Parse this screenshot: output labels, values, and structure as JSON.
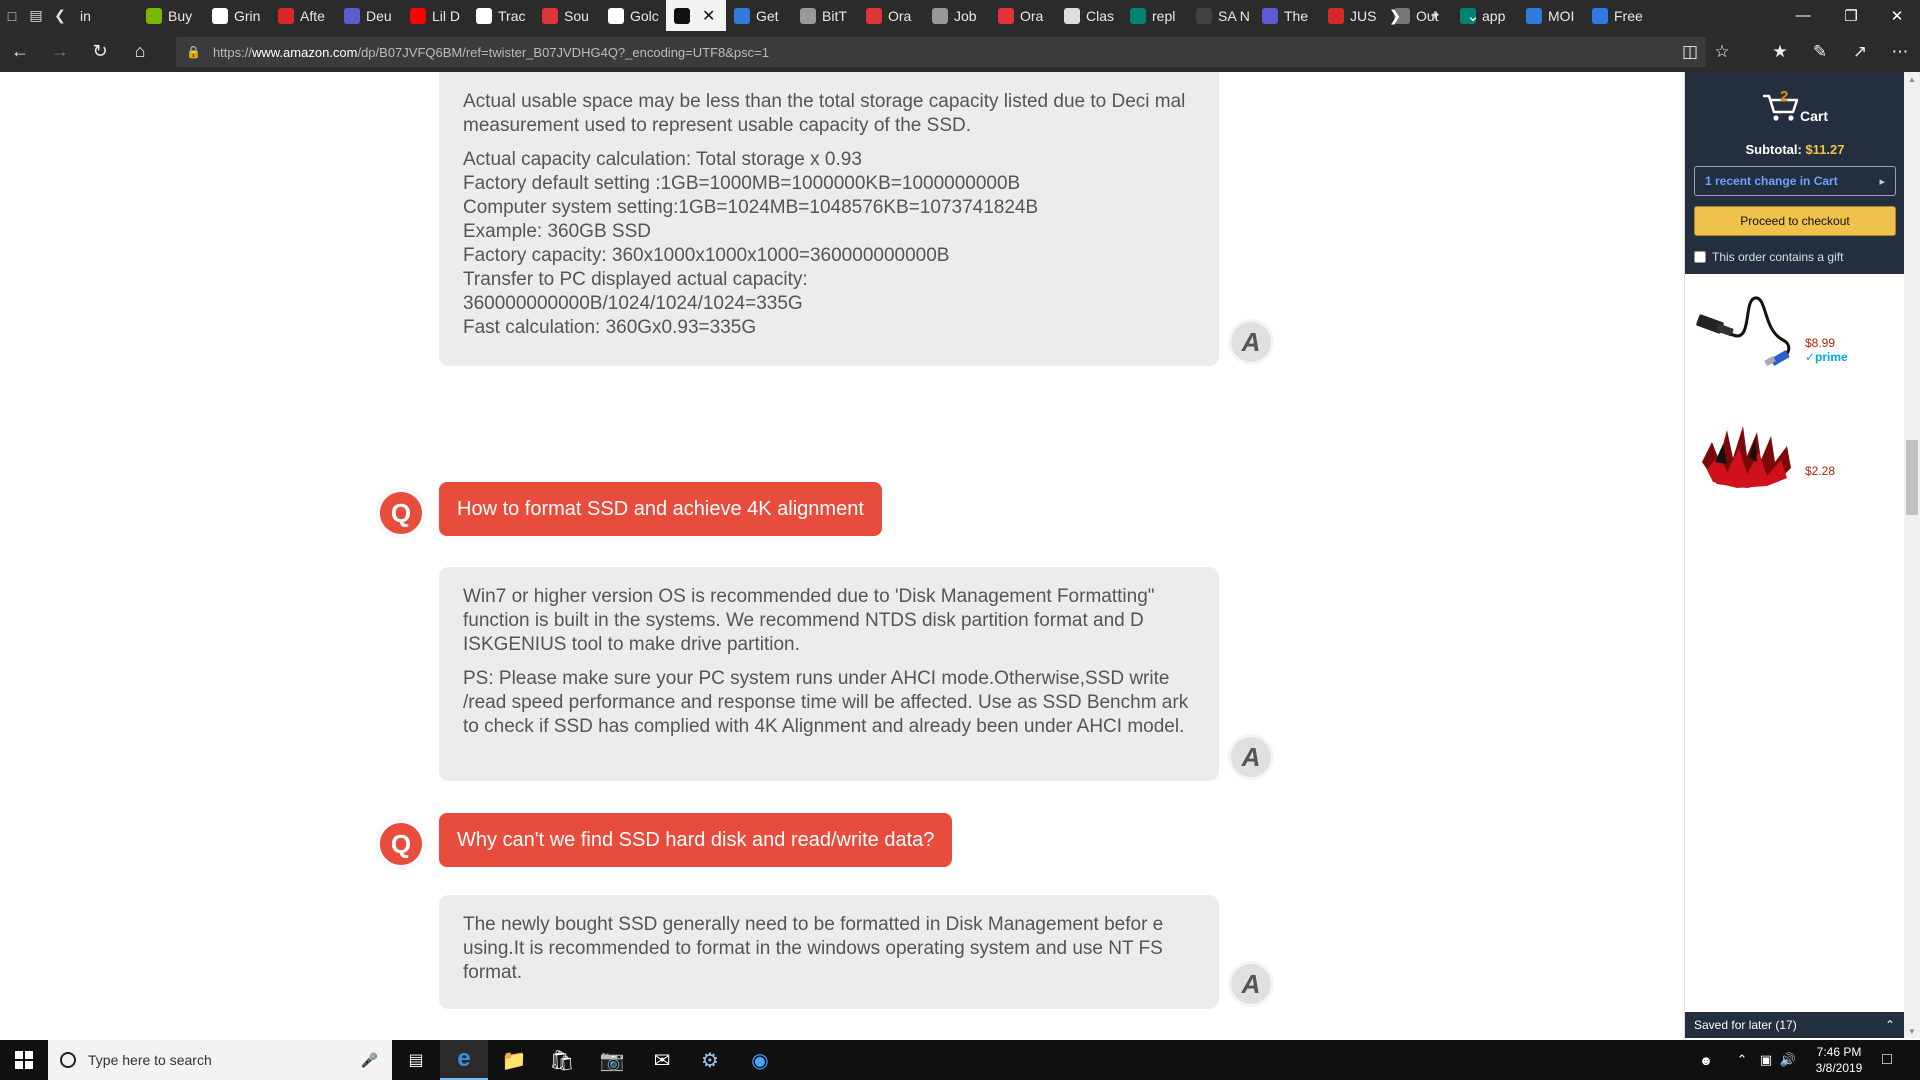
{
  "browser": {
    "tabs": [
      {
        "label": "in",
        "icon": "back-chevron-icon",
        "color": "#2b2b2b"
      },
      {
        "label": "Buy",
        "icon": "nvidia-icon",
        "color": "#76b900"
      },
      {
        "label": "Grin",
        "icon": "grid-icon",
        "color": "#ffffff"
      },
      {
        "label": "Afte",
        "icon": "red-site-icon",
        "color": "#d62828"
      },
      {
        "label": "Deu",
        "icon": "g-icon",
        "color": "#5b5bd6"
      },
      {
        "label": "Lil D",
        "icon": "youtube-icon",
        "color": "#ff0000"
      },
      {
        "label": "Trac",
        "icon": "amazon-icon",
        "color": "#ffffff"
      },
      {
        "label": "Sou",
        "icon": "oracle-icon",
        "color": "#e0343c"
      },
      {
        "label": "Golc",
        "icon": "amazon-icon",
        "color": "#ffffff"
      },
      {
        "label": "Get",
        "icon": "co-icon",
        "color": "#2f7ce0"
      },
      {
        "label": "BitT",
        "icon": "page-icon",
        "color": "#999999"
      },
      {
        "label": "Ora",
        "icon": "oracle-icon",
        "color": "#e0343c"
      },
      {
        "label": "Job",
        "icon": "page-icon",
        "color": "#999999"
      },
      {
        "label": "Ora",
        "icon": "oracle-icon",
        "color": "#e0343c"
      },
      {
        "label": "Clas",
        "icon": "globe-icon",
        "color": "#dddddd"
      },
      {
        "label": "repl",
        "icon": "bing-icon",
        "color": "#008373"
      },
      {
        "label": "SA N",
        "icon": "sa-icon",
        "color": "#444444"
      },
      {
        "label": "The",
        "icon": "g-icon",
        "color": "#5b5bd6"
      },
      {
        "label": "JUS",
        "icon": "red-round-icon",
        "color": "#d62828"
      },
      {
        "label": "Out",
        "icon": "grey-round-icon",
        "color": "#777777"
      },
      {
        "label": "app",
        "icon": "bing-icon",
        "color": "#008373"
      },
      {
        "label": "MOI",
        "icon": "blue-bar-icon",
        "color": "#2f7ce0"
      },
      {
        "label": "Free",
        "icon": "blue-bar-icon",
        "color": "#2f7ce0"
      }
    ],
    "url_prefix": "https://",
    "url_host": "www.amazon.com",
    "url_path": "/dp/B07JVFQ6BM/ref=twister_B07JVDHG4Q?_encoding=UTF8&psc=1"
  },
  "qa": {
    "answer1": {
      "para1": "Actual usable space may be less than the total storage capacity listed due to Deci mal measurement used to represent usable capacity of the SSD.",
      "lines": [
        "Actual capacity calculation: Total storage x 0.93",
        "Factory default setting :1GB=1000MB=1000000KB=1000000000B",
        "Computer system setting:1GB=1024MB=1048576KB=1073741824B",
        "Example: 360GB SSD",
        "Factory capacity: 360x1000x1000x1000=360000000000B",
        "Transfer to PC displayed actual capacity:",
        "360000000000B/1024/1024/1024=335G",
        "Fast calculation: 360Gx0.93=335G"
      ]
    },
    "question2": "How to format SSD and achieve 4K alignment",
    "answer2": {
      "para1": "Win7 or higher version OS is recommended due to 'Disk Management Formatting\" function is built in the systems. We recommend NTDS disk partition format and D ISKGENIUS tool to make drive partition.",
      "para2": "PS: Please make sure your PC system runs under AHCI mode.Otherwise,SSD write /read speed performance and response time will be affected. Use as SSD Benchm ark to check if SSD has complied with 4K Alignment and already been under AHCI model."
    },
    "question3": "Why can't we find SSD hard disk and read/write data?",
    "answer3": {
      "para1": "The newly bought SSD generally need to be formatted in Disk Management befor e using.It is recommended to format in the windows operating system and use NT FS format."
    },
    "q_letter": "Q",
    "a_letter": "A"
  },
  "cart": {
    "count": "2",
    "label": "Cart",
    "subtotal_label": "Subtotal:",
    "subtotal_value": "$11.27",
    "recent_change": "1 recent change in Cart",
    "checkout": "Proceed to checkout",
    "gift": "This order contains a gift",
    "items": [
      {
        "price": "$8.99",
        "prime": "✓prime"
      },
      {
        "price": "$2.28"
      }
    ],
    "saved_for_later": "Saved for later (17)"
  },
  "taskbar": {
    "search_placeholder": "Type here to search",
    "time": "7:46 PM",
    "date": "3/8/2019"
  },
  "colors": {
    "question_red": "#e74c3c",
    "answer_bg": "#ececec",
    "amazon_dark": "#232f3e",
    "checkout_yellow": "#f0c14b"
  }
}
